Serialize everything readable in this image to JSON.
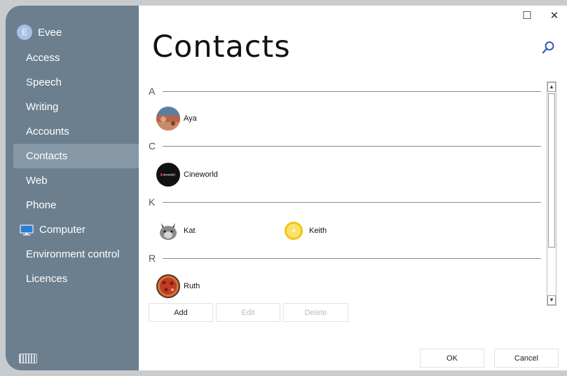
{
  "sidebar": {
    "user": {
      "initial": "E",
      "name": "Evee"
    },
    "items": [
      {
        "label": "Access"
      },
      {
        "label": "Speech"
      },
      {
        "label": "Writing"
      },
      {
        "label": "Accounts"
      },
      {
        "label": "Contacts",
        "active": true
      },
      {
        "label": "Web"
      },
      {
        "label": "Phone"
      },
      {
        "label": "Computer",
        "icon": "monitor-icon"
      },
      {
        "label": "Environment control"
      },
      {
        "label": "Licences"
      }
    ],
    "keyboard_icon": "keyboard-icon"
  },
  "main": {
    "title": "Contacts",
    "search_icon": "search-icon",
    "sections": [
      {
        "letter": "A",
        "contacts": [
          "Aya"
        ]
      },
      {
        "letter": "C",
        "contacts": [
          "Cineworld"
        ]
      },
      {
        "letter": "K",
        "contacts": [
          "Kat",
          "Keith"
        ]
      },
      {
        "letter": "R",
        "contacts": [
          "Ruth"
        ]
      }
    ],
    "cineworld_logo_text": "cineworld",
    "actions": {
      "add": "Add",
      "edit": "Edit",
      "delete": "Delete"
    },
    "dialog": {
      "ok": "OK",
      "cancel": "Cancel"
    }
  },
  "window": {
    "maximize_glyph": "☐",
    "close_glyph": "✕"
  },
  "colors": {
    "sidebar": "#6c7f8f",
    "active_item": "#8798a6",
    "avatar": "#a9c0e6"
  }
}
